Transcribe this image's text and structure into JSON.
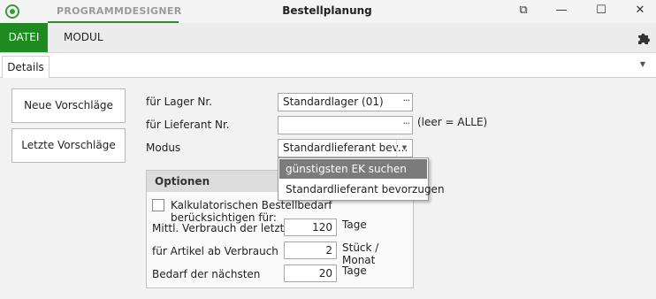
{
  "titlebar": {
    "designer_tab": "PROGRAMMDESIGNER",
    "title": "Bestellplanung",
    "restore_symbol": "⧉",
    "minimize_symbol": "—",
    "maximize_symbol": "☐",
    "close_symbol": "✕"
  },
  "ribbon": {
    "datei": "DATEI",
    "modul": "MODUL"
  },
  "tabs": {
    "details": "Details",
    "arrow": "▼"
  },
  "buttons": {
    "neue": "Neue Vorschläge",
    "letzte": "Letzte Vorschläge"
  },
  "form": {
    "lager_label": "für Lager Nr.",
    "lager_value": "Standardlager (01)",
    "lieferant_label": "für Lieferant Nr.",
    "lieferant_value": "",
    "lieferant_hint": "(leer = ALLE)",
    "modus_label": "Modus",
    "modus_value": "Standardlieferant bev...",
    "ellipsis": "···",
    "dd_arrow": "▼"
  },
  "dropdown": {
    "options": [
      "günstigsten EK suchen",
      "Standardlieferant bevorzugen"
    ]
  },
  "options": {
    "header": "Optionen",
    "checkbox_label": "Kalkulatorischen Bestellbedarf berücksichtigen für:",
    "verbrauch_label": "Mittl. Verbrauch der letzten",
    "verbrauch_value": "120",
    "verbrauch_unit": "Tage",
    "artikel_label": "für Artikel ab Verbrauch",
    "artikel_value": "2",
    "artikel_unit": "Stück / Monat",
    "bedarf_label": "Bedarf der nächsten",
    "bedarf_value": "20",
    "bedarf_unit": "Tage"
  },
  "colors": {
    "accent": "#1f8a1f",
    "dropdown_highlight": "#7b7b7b"
  },
  "icons": [
    "app-logo-icon",
    "restore-icon",
    "minimize-icon",
    "maximize-icon",
    "close-icon",
    "puzzle-icon",
    "ellipsis-icon",
    "chevron-down-icon"
  ]
}
